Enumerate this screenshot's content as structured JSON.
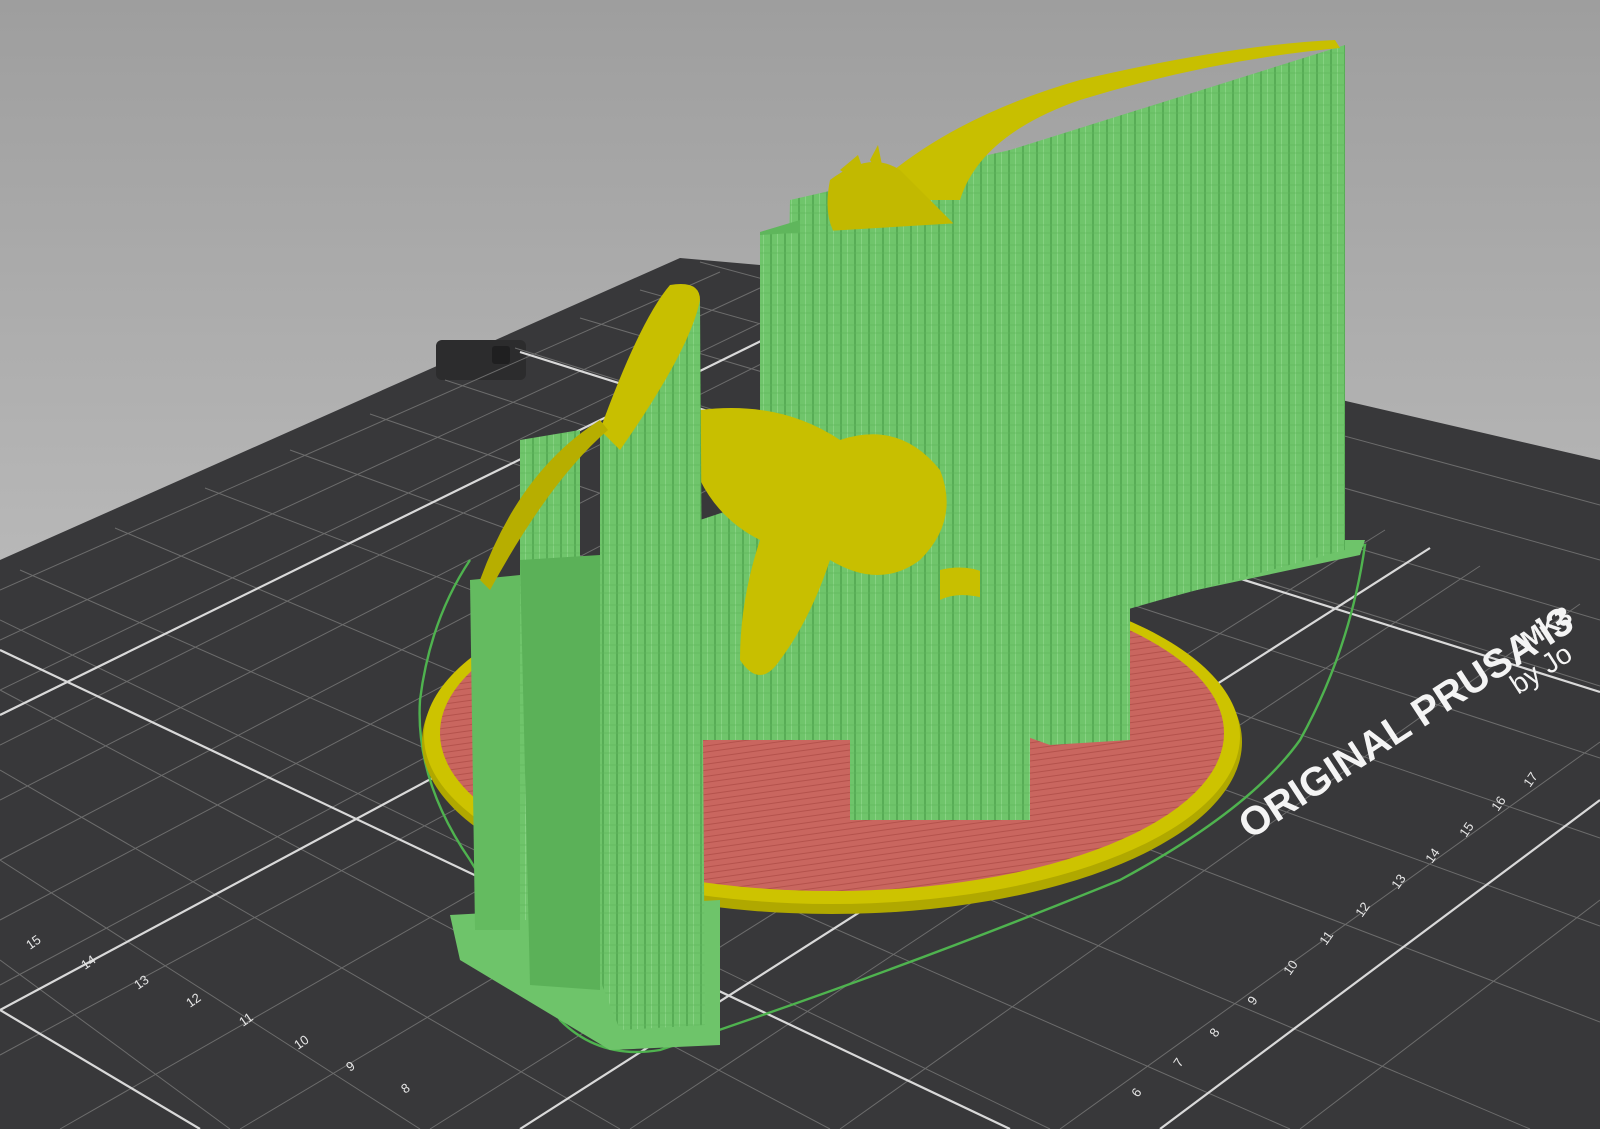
{
  "scene": {
    "bed_logo_text": "ORIGINAL PRUSA i3",
    "bed_model_text": "MK3",
    "bed_author_text": "by Jo",
    "ruler_left": [
      "15",
      "14",
      "13",
      "12",
      "11",
      "10",
      "9",
      "8"
    ],
    "ruler_right": [
      "6",
      "7",
      "8",
      "9",
      "10",
      "11",
      "12",
      "13",
      "14",
      "15",
      "16",
      "17"
    ]
  },
  "colors": {
    "background_top": "#a2a2a2",
    "background_bottom": "#cfcfcf",
    "bed": "#3a3a3c",
    "bed_grid": "#7a7a7a",
    "bed_grid_major": "#d8d8d8",
    "model": "#c8bf00",
    "support": "#6ec46a",
    "support_dark": "#4ea04c",
    "raft": "#c86a62",
    "skirt": "#4fb34f"
  },
  "icons": {
    "bed_mount": "bed-mount-knob-icon"
  }
}
